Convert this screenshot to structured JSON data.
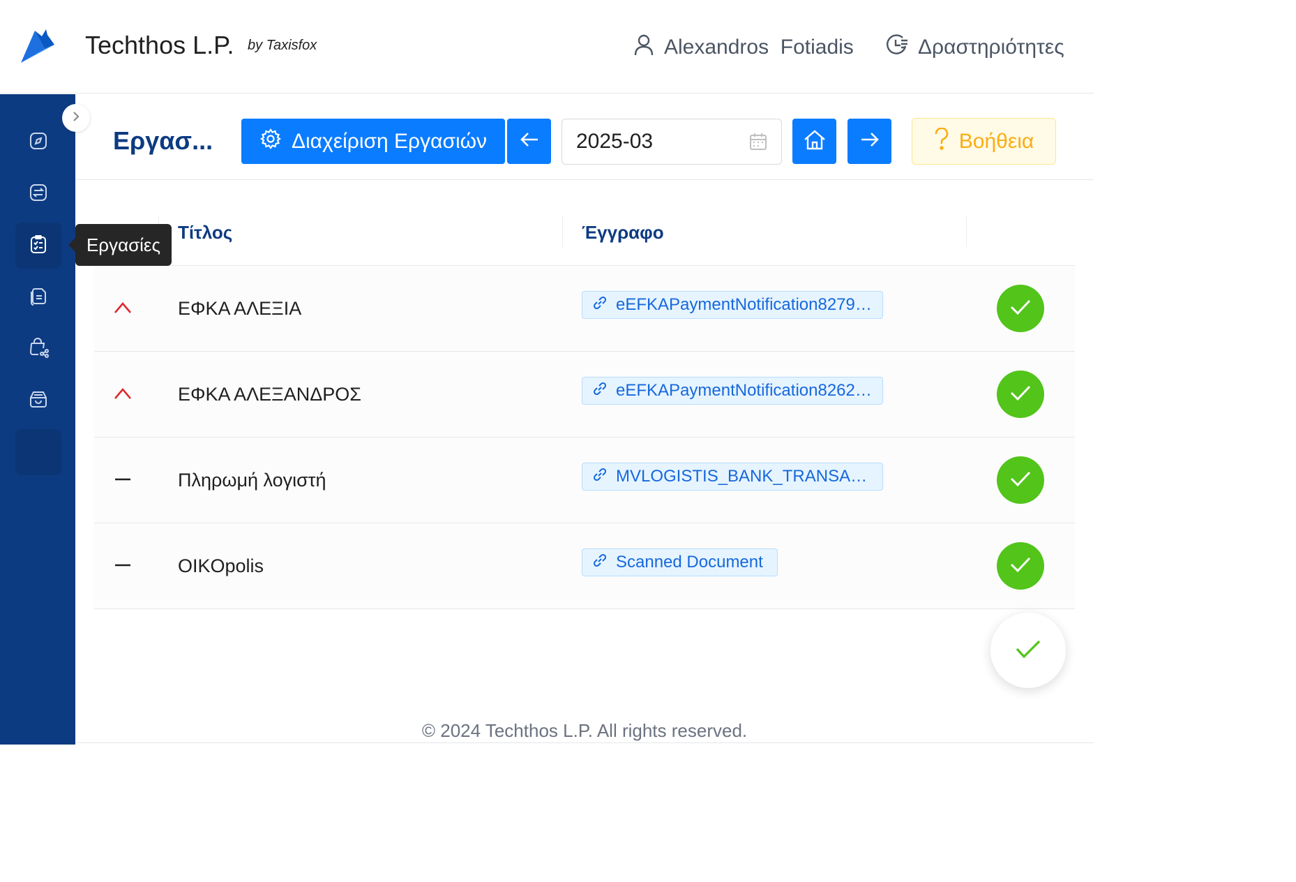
{
  "header": {
    "app_title": "Techthos L.P.",
    "by_line": "by Taxisfox",
    "user_name": "Alexandros  Fotiadis",
    "activity_label": "Δραστηριότητες"
  },
  "sidebar": {
    "items": [
      {
        "icon": "compass-icon"
      },
      {
        "icon": "transfer-icon"
      },
      {
        "icon": "clipboard-check-icon",
        "active": true
      },
      {
        "icon": "documents-icon"
      },
      {
        "icon": "cart-share-icon"
      },
      {
        "icon": "archive-icon"
      }
    ],
    "tooltip": "Εργασίες"
  },
  "toolbar": {
    "page_title": "Εργασ...",
    "manage_label": "Διαχείριση Εργασιών",
    "date_value": "2025-03",
    "help_label": "Βοήθεια"
  },
  "table": {
    "columns": [
      "Τίτλος",
      "Έγγραφο"
    ],
    "rows": [
      {
        "priority": "high",
        "title": "ΕΦΚΑ ΑΛΕΞΙΑ",
        "document": "eEFKAPaymentNotification8279…",
        "done": true
      },
      {
        "priority": "high",
        "title": "ΕΦΚΑ ΑΛΕΞΑΝΔΡΟΣ",
        "document": "eEFKAPaymentNotification8262…",
        "done": true
      },
      {
        "priority": "normal",
        "title": "Πληρωμή λογιστή",
        "document": "MVLOGISTIS_BANK_TRANSA…",
        "done": true
      },
      {
        "priority": "normal",
        "title": "OIKOpolis",
        "document": "Scanned Document",
        "done": true
      }
    ]
  },
  "colors": {
    "primary": "#0a7cff",
    "sidebar": "#0d3b82",
    "success": "#52c41a",
    "high_priority": "#e0282e",
    "warning": "#faad14"
  },
  "footer": {
    "copyright": "© 2024 Techthos L.P. All rights reserved."
  }
}
